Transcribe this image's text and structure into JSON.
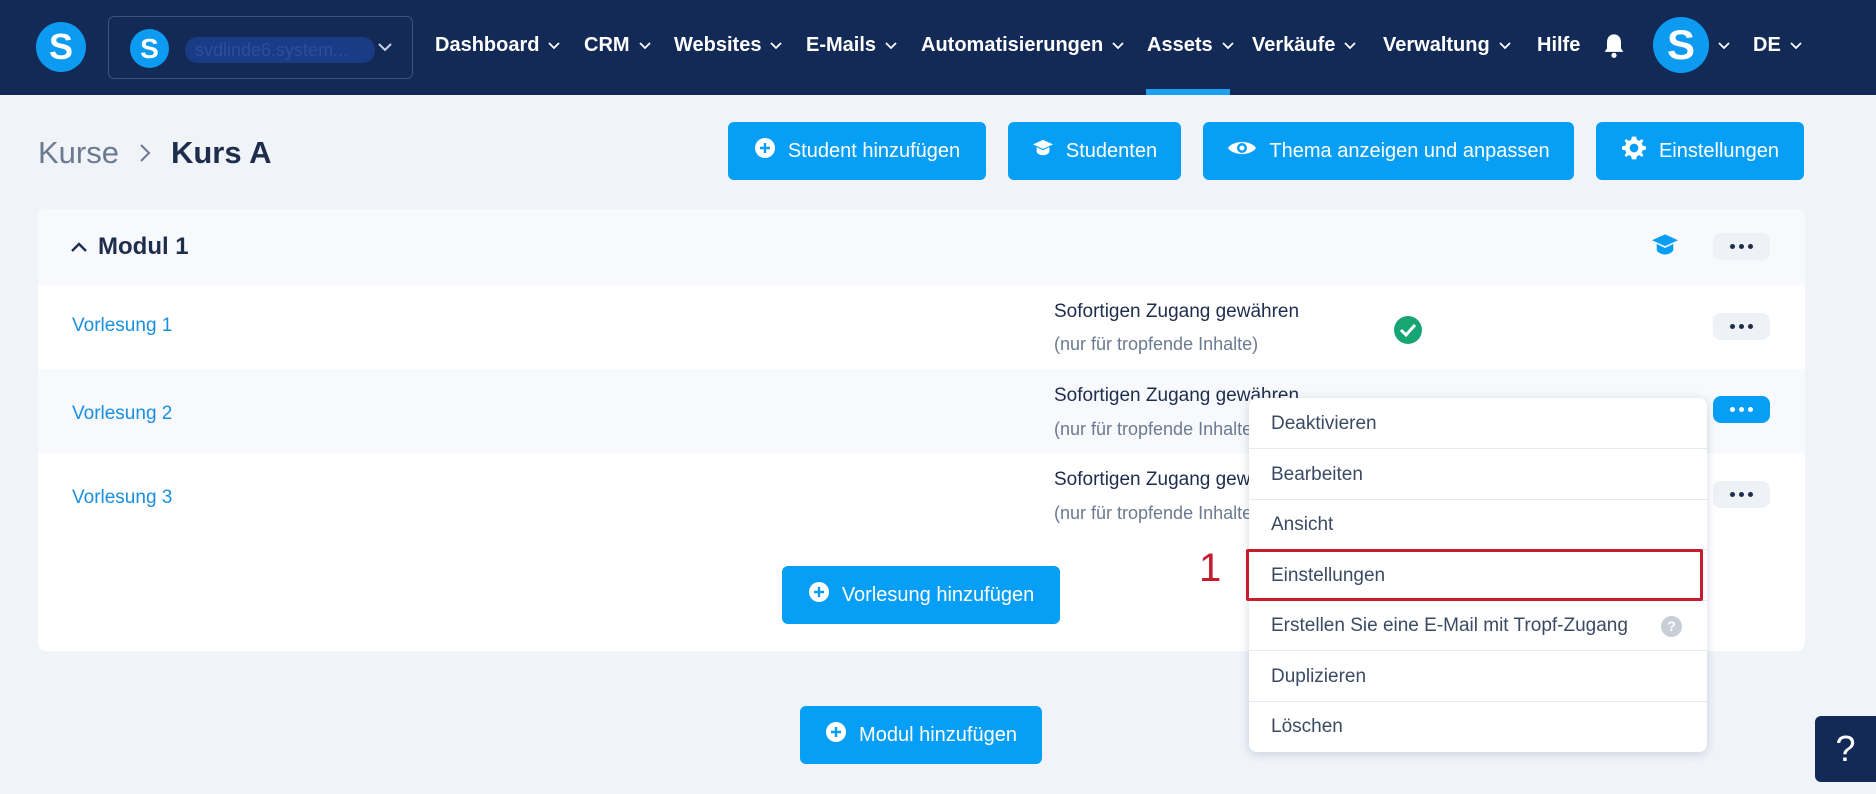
{
  "nav": {
    "account_name": "svdlinde6.system...",
    "items": [
      "Dashboard",
      "CRM",
      "Websites",
      "E-Mails",
      "Automatisierungen",
      "Assets",
      "Verkäufe",
      "Verwaltung"
    ],
    "help": "Hilfe",
    "language": "DE",
    "logo_letter": "S",
    "active": "Assets"
  },
  "header": {
    "breadcrumb_parent": "Kurse",
    "breadcrumb_current": "Kurs A",
    "buttons": {
      "add_student": "Student hinzufügen",
      "students": "Studenten",
      "theme": "Thema anzeigen und anpassen",
      "settings": "Einstellungen"
    }
  },
  "module": {
    "title": "Modul 1",
    "lectures": [
      {
        "title": "Vorlesung 1",
        "access": "Sofortigen Zugang gewähren",
        "note": "(nur für tropfende Inhalte)"
      },
      {
        "title": "Vorlesung 2",
        "access": "Sofortigen Zugang gewähren",
        "note": "(nur für tropfende Inhalte)"
      },
      {
        "title": "Vorlesung 3",
        "access": "Sofortigen Zugang gewähren",
        "note": "(nur für tropfende Inhalte)"
      }
    ],
    "add_lecture": "Vorlesung hinzufügen"
  },
  "add_module": "Modul hinzufügen",
  "menu": {
    "items": [
      "Deaktivieren",
      "Bearbeiten",
      "Ansicht",
      "Einstellungen",
      "Erstellen Sie eine E-Mail mit Tropf-Zugang",
      "Duplizieren",
      "Löschen"
    ],
    "highlighted": "Einstellungen",
    "step_number": "1"
  },
  "help_fab": "?",
  "colors": {
    "navbar": "#132a57",
    "primary": "#079ef5",
    "success": "#17a673",
    "highlight": "#c71b2e"
  }
}
